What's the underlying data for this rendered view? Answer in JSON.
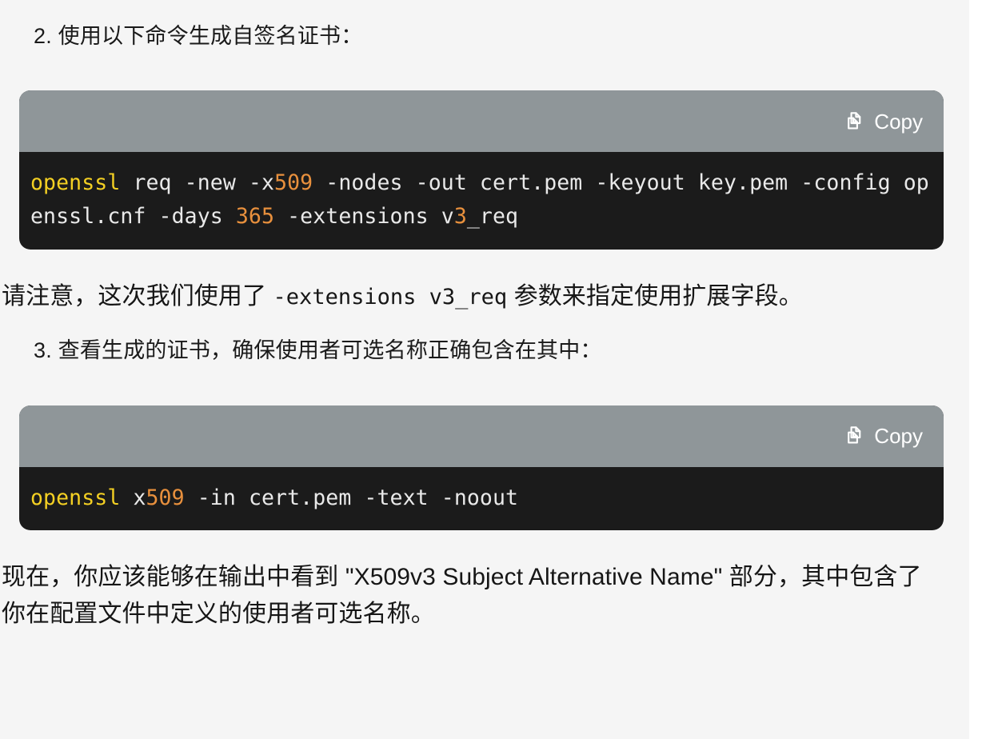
{
  "theme": {
    "page_background": "#f5f5f5",
    "outer_background": "#ffffff",
    "code_header_background": "#8f9699",
    "code_body_background": "#1b1b1b",
    "code_text": "#e9e9e9",
    "keyword_color": "#f4d023",
    "number_color": "#e8903d",
    "body_text": "#161616"
  },
  "steps": {
    "step2": "2. 使用以下命令生成自签名证书：",
    "step3": "3. 查看生成的证书，确保使用者可选名称正确包含在其中："
  },
  "code_blocks": [
    {
      "copy_label": "Copy",
      "copy_icon": "copy-icon",
      "language": "shell",
      "full_command": "openssl req -new -x509 -nodes -out cert.pem -keyout key.pem -config openssl.cnf -days 365 -extensions v3_req",
      "tokens": [
        {
          "text": "openssl",
          "type": "cmd"
        },
        {
          "text": " req -new -x",
          "type": "def"
        },
        {
          "text": "509",
          "type": "num"
        },
        {
          "text": " -nodes -out cert.pem -keyout key.pem -config openssl.cnf -days ",
          "type": "def"
        },
        {
          "text": "365",
          "type": "num"
        },
        {
          "text": " -extensions v",
          "type": "def"
        },
        {
          "text": "3",
          "type": "num"
        },
        {
          "text": "_req",
          "type": "def"
        }
      ]
    },
    {
      "copy_label": "Copy",
      "copy_icon": "copy-icon",
      "language": "shell",
      "full_command": "openssl x509 -in cert.pem -text -noout",
      "tokens": [
        {
          "text": "openssl",
          "type": "cmd"
        },
        {
          "text": " x",
          "type": "def"
        },
        {
          "text": "509",
          "type": "num"
        },
        {
          "text": " -in cert.pem -text -noout",
          "type": "def"
        }
      ]
    }
  ],
  "paragraphs": {
    "note": {
      "before": "请注意，这次我们使用了 ",
      "code": "-extensions v3_req",
      "after": " 参数来指定使用扩展字段。"
    },
    "closing": "现在，你应该能够在输出中看到 \"X509v3 Subject Alternative Name\" 部分，其中包含了你在配置文件中定义的使用者可选名称。"
  }
}
